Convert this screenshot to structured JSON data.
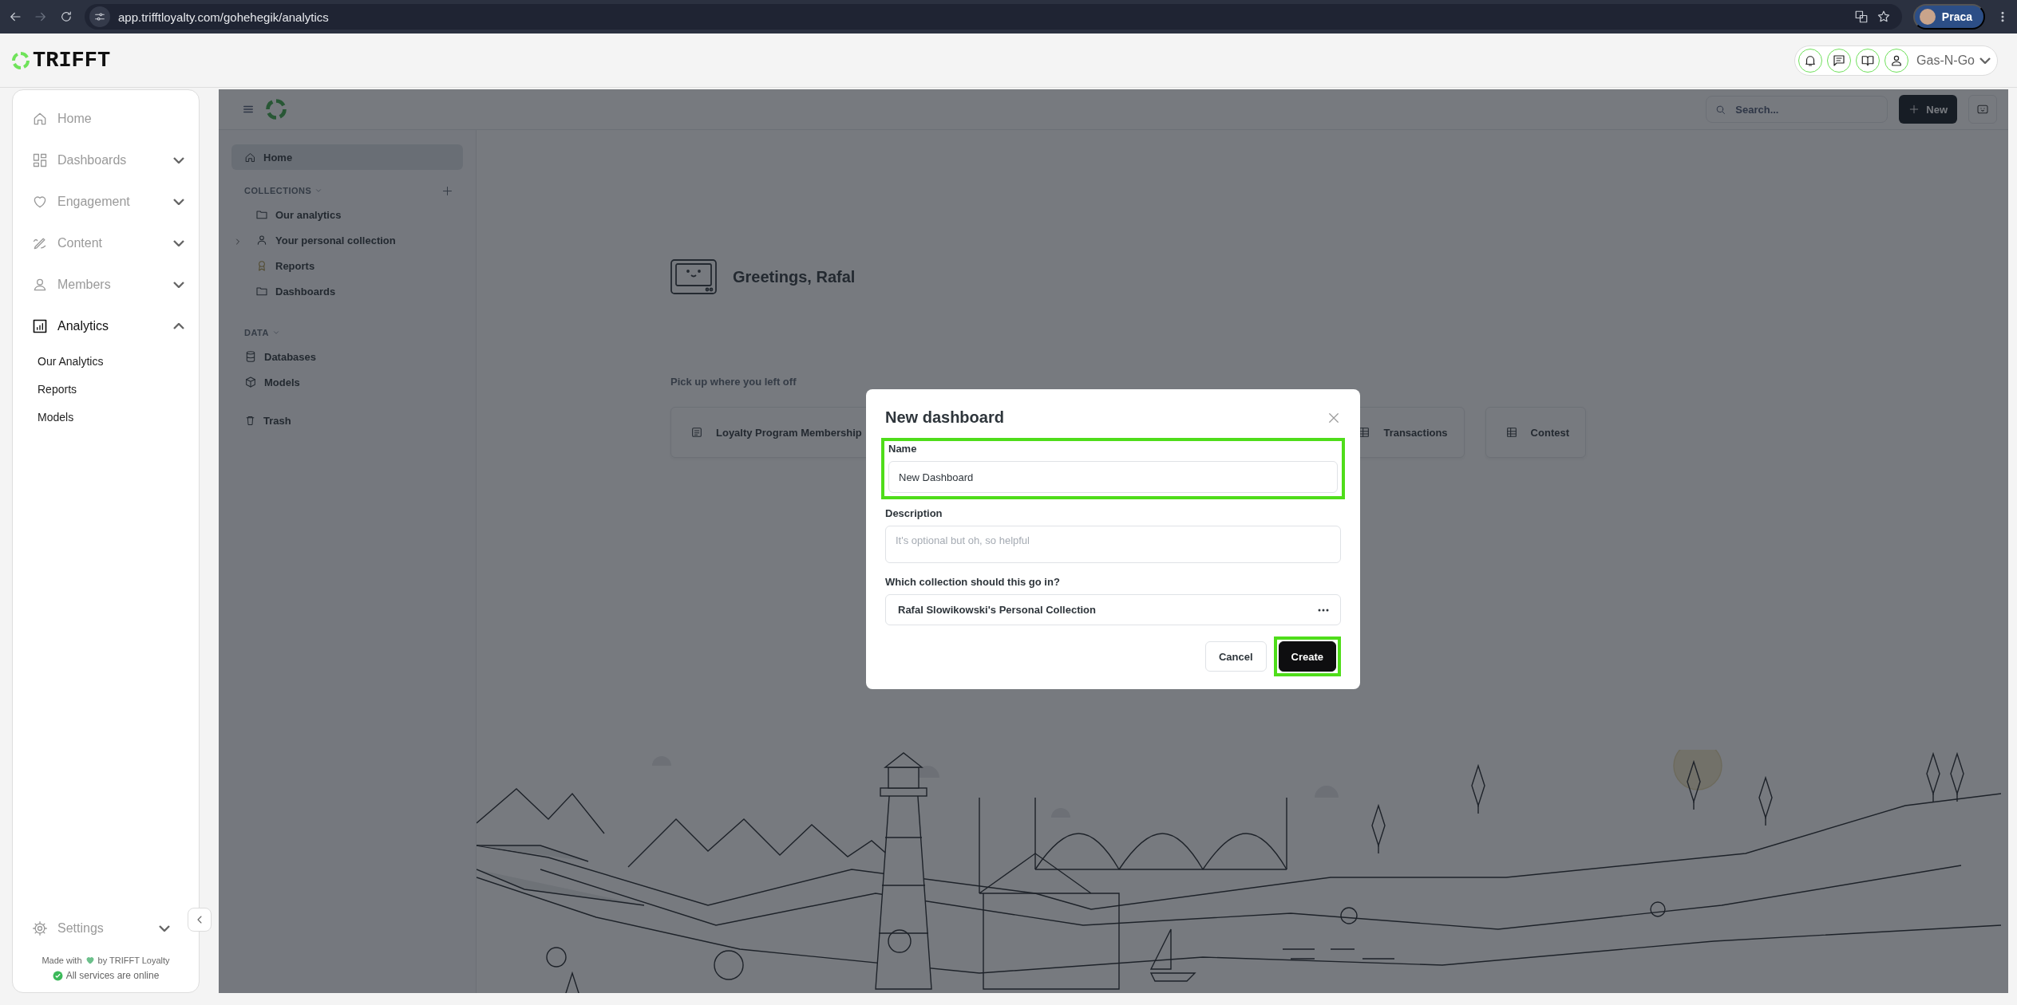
{
  "browser": {
    "url": "app.trifftloyalty.com/gohehegik/analytics",
    "profile": "Praca"
  },
  "header": {
    "logo": "TRIFFT",
    "account": "Gas-N-Go"
  },
  "sidebar": {
    "items": [
      {
        "label": "Home",
        "kind": "link",
        "selected": false
      },
      {
        "label": "Dashboards",
        "kind": "group",
        "selected": false,
        "expanded": false
      },
      {
        "label": "Engagement",
        "kind": "group",
        "selected": false,
        "expanded": false
      },
      {
        "label": "Content",
        "kind": "group",
        "selected": false,
        "expanded": false
      },
      {
        "label": "Members",
        "kind": "group",
        "selected": false,
        "expanded": false
      },
      {
        "label": "Analytics",
        "kind": "group",
        "selected": true,
        "expanded": true,
        "children": [
          {
            "label": "Our Analytics"
          },
          {
            "label": "Reports"
          },
          {
            "label": "Models"
          }
        ]
      }
    ],
    "settings": {
      "label": "Settings",
      "expanded": false
    },
    "footer": {
      "made_with": "Made with",
      "by": "by TRIFFT Loyalty",
      "status": "All services are online"
    }
  },
  "analytics": {
    "search": {
      "placeholder": "Search..."
    },
    "new_button": "New",
    "home": {
      "label": "Home",
      "selected": true
    },
    "collections": {
      "title": "COLLECTIONS",
      "items": [
        {
          "label": "Our analytics",
          "kind": "folder"
        },
        {
          "label": "Your personal collection",
          "kind": "personal"
        },
        {
          "label": "Reports",
          "kind": "official"
        },
        {
          "label": "Dashboards",
          "kind": "folder"
        }
      ]
    },
    "data": {
      "title": "DATA",
      "items": [
        {
          "label": "Databases",
          "kind": "database"
        },
        {
          "label": "Models",
          "kind": "model"
        }
      ]
    },
    "trash": {
      "label": "Trash"
    },
    "greeting": "Greetings, Rafal",
    "recent": {
      "title": "Pick up where you left off",
      "items": [
        {
          "label": "Loyalty Program Membership",
          "kind": "list"
        },
        {
          "label": "Transactions",
          "kind": "table"
        },
        {
          "label": "Contest",
          "kind": "table"
        }
      ]
    }
  },
  "dialog": {
    "title": "New dashboard",
    "fields": [
      {
        "label": "Name",
        "kind": "text",
        "value": "New Dashboard",
        "highlighted": true
      },
      {
        "label": "Description",
        "kind": "textarea",
        "placeholder": "It's optional but oh, so helpful",
        "highlighted": false
      },
      {
        "label": "Which collection should this go in?",
        "kind": "picker",
        "value": "Rafal Slowikowski's Personal Collection",
        "highlighted": false
      }
    ],
    "buttons": [
      {
        "label": "Cancel",
        "kind": "secondary",
        "highlighted": false
      },
      {
        "label": "Create",
        "kind": "primary",
        "highlighted": true
      }
    ]
  }
}
